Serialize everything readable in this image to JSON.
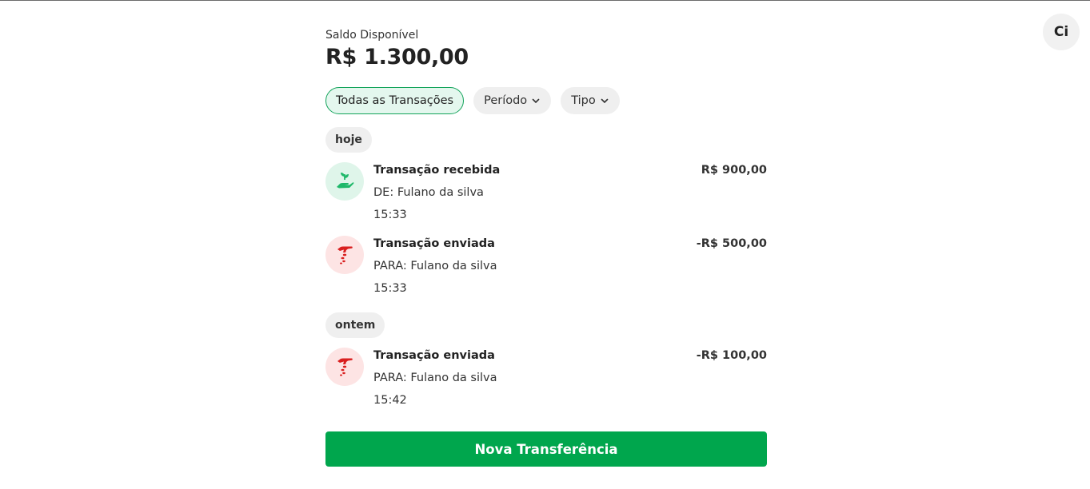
{
  "user": {
    "avatar_initials": "Ci"
  },
  "balance": {
    "label": "Saldo Disponível",
    "value": "R$ 1.300,00"
  },
  "filters": [
    {
      "label": "Todas as Transações",
      "active": true,
      "has_dropdown": false
    },
    {
      "label": "Período",
      "active": false,
      "has_dropdown": true,
      "icon": "chevron-down-icon"
    },
    {
      "label": "Tipo",
      "active": false,
      "has_dropdown": true,
      "icon": "chevron-down-icon"
    }
  ],
  "groups": [
    {
      "day": "hoje",
      "transactions": [
        {
          "kind": "received",
          "icon": "hand-plant-icon",
          "title": "Transação recebida",
          "party": "DE: Fulano da silva",
          "time": "15:33",
          "amount": "R$ 900,00"
        },
        {
          "kind": "sent",
          "icon": "hand-coins-icon",
          "title": "Transação enviada",
          "party": "PARA: Fulano da silva",
          "time": "15:33",
          "amount": "-R$ 500,00"
        }
      ]
    },
    {
      "day": "ontem",
      "transactions": [
        {
          "kind": "sent",
          "icon": "hand-coins-icon",
          "title": "Transação enviada",
          "party": "PARA: Fulano da silva",
          "time": "15:42",
          "amount": "-R$ 100,00"
        }
      ]
    }
  ],
  "actions": {
    "new_transfer_label": "Nova Transferência"
  },
  "colors": {
    "primary_green": "#00a64d",
    "received_bg": "#dff5ea",
    "received_icon": "#1fb86a",
    "sent_bg": "#fde4e4",
    "sent_icon": "#d92020"
  }
}
